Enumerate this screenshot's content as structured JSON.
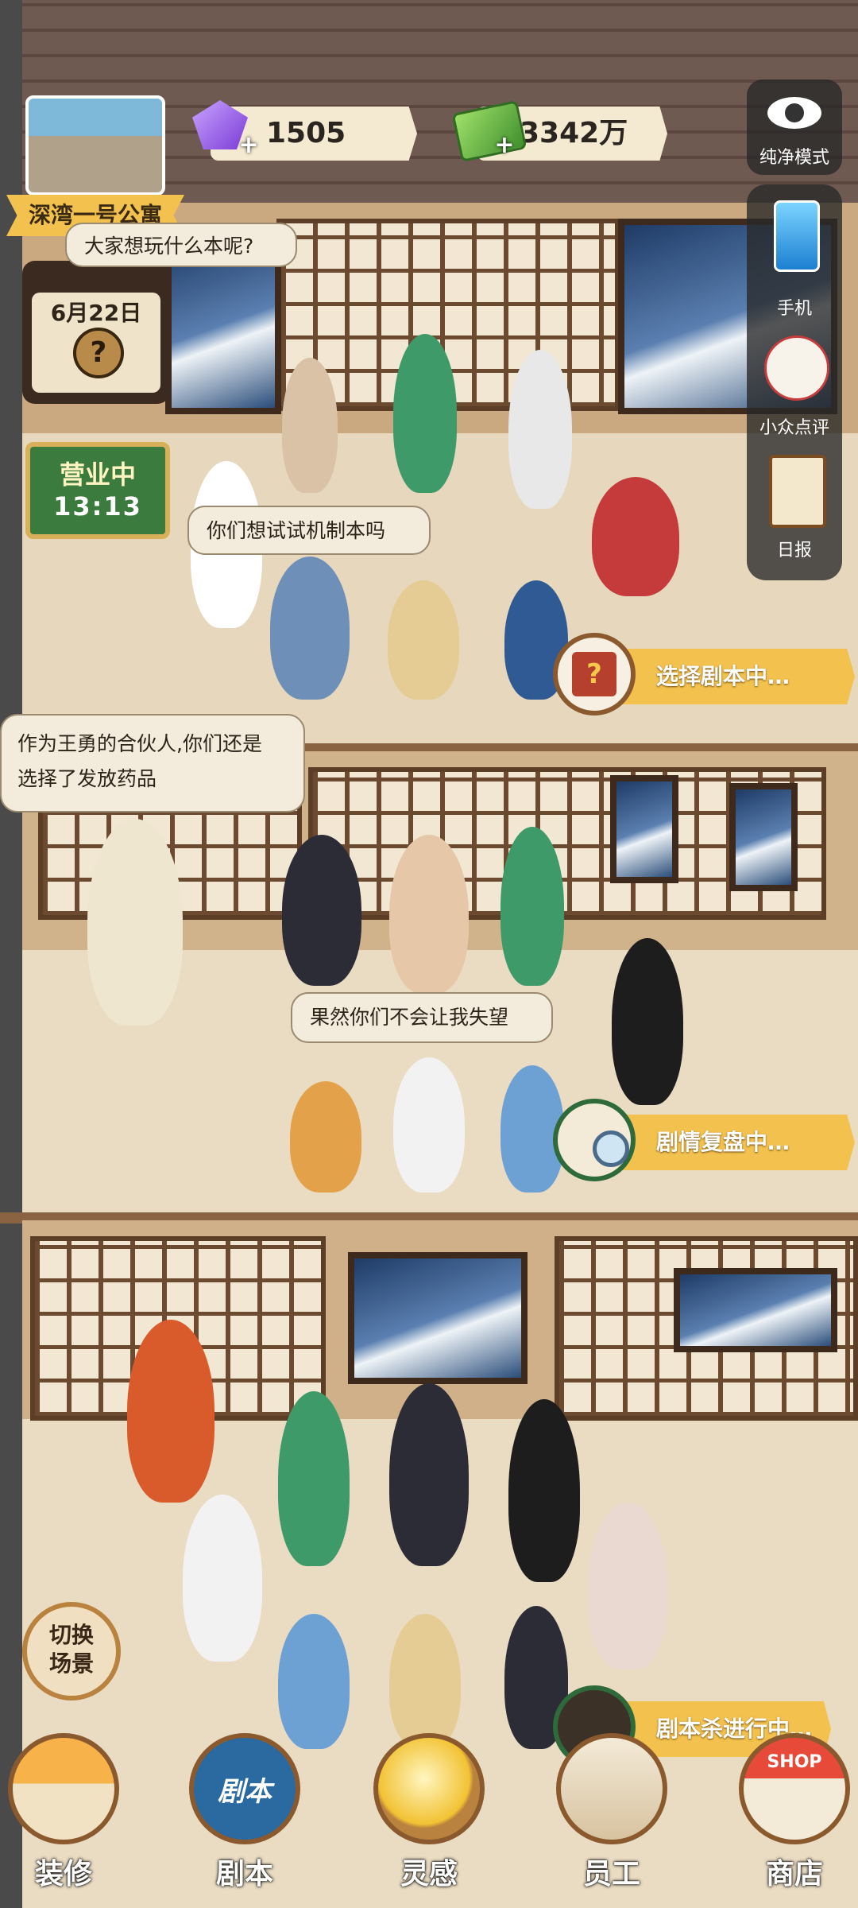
{
  "hud": {
    "gems": "1505",
    "cash": "3342万",
    "location_name": "深湾一号公寓",
    "date": "6月22日",
    "date_icon": "?",
    "status_label": "营业中",
    "status_time": "13:13"
  },
  "side_menu": {
    "items": [
      {
        "label": "纯净模式",
        "icon": "eye-icon"
      },
      {
        "label": "手机",
        "icon": "phone-icon"
      },
      {
        "label": "小众点评",
        "icon": "lucky-cat-icon"
      },
      {
        "label": "日报",
        "icon": "clipboard-icon"
      }
    ]
  },
  "rooms": [
    {
      "bubbles": [
        "大家想玩什么本呢?",
        "你们想试试机制本吗"
      ],
      "progress": "选择剧本中…",
      "progress_icon": "?"
    },
    {
      "bubbles": [
        "作为王勇的合伙人,你们还是\n选择了发放药品",
        "果然你们不会让我失望"
      ],
      "progress": "剧情复盘中…"
    },
    {
      "progress": "剧本杀进行中…"
    }
  ],
  "scene_button": {
    "line1": "切换",
    "line2": "场景"
  },
  "bottom_nav": [
    {
      "label": "装修",
      "icon": "house-icon"
    },
    {
      "label": "剧本",
      "icon": "book-icon",
      "icon_text": "剧本"
    },
    {
      "label": "灵感",
      "icon": "lightbulb-icon"
    },
    {
      "label": "员工",
      "icon": "badge-icon"
    },
    {
      "label": "商店",
      "icon": "shop-icon",
      "icon_text": "SHOP"
    }
  ],
  "colors": {
    "banner": "#f2c14e",
    "status_green": "#3b7b3d",
    "side_panel": "#282828"
  }
}
